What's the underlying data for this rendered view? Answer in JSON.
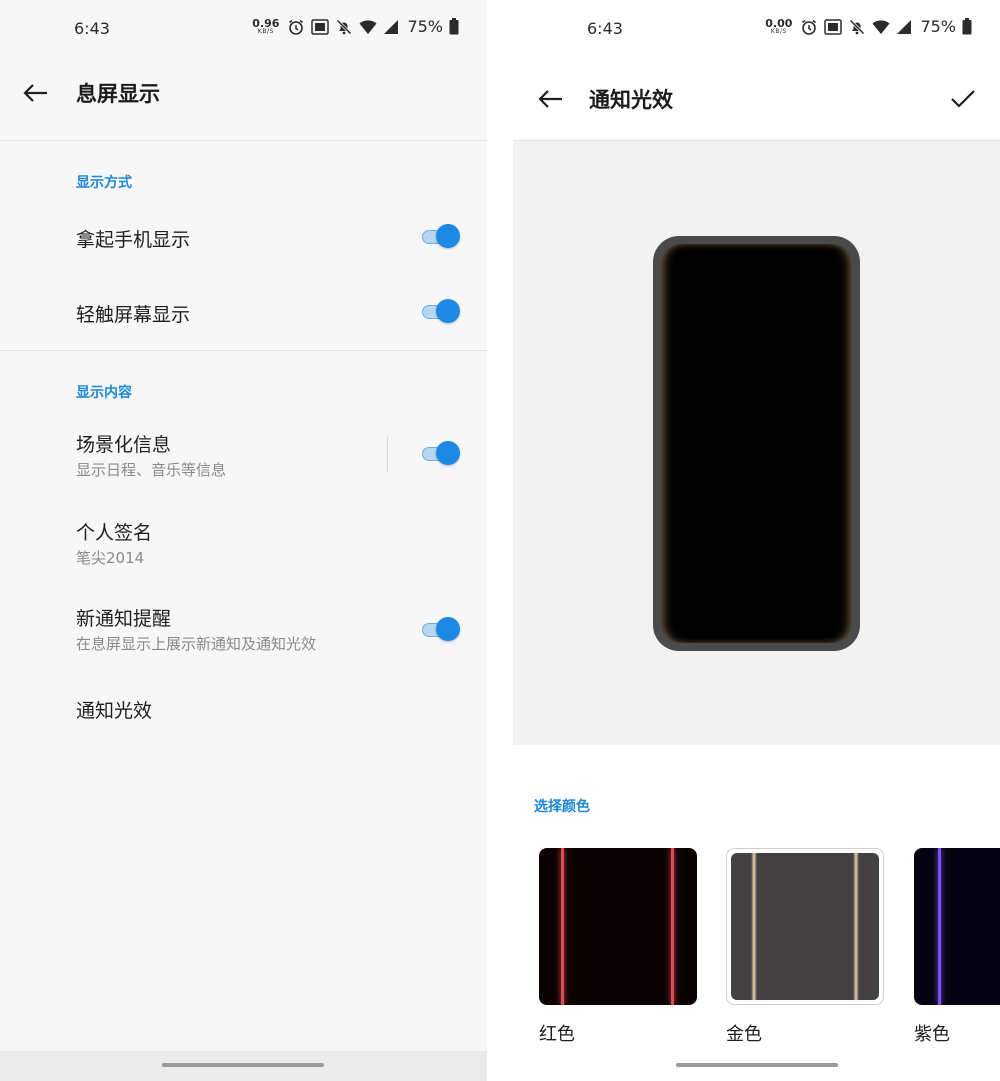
{
  "left_screen": {
    "status_bar": {
      "time": "6:43",
      "net_speed_value": "0.96",
      "net_speed_unit": "KB/S",
      "volte_label": "Vo LTE",
      "battery_pct": "75%"
    },
    "appbar": {
      "title": "息屏显示"
    },
    "sections": {
      "display_mode": {
        "title": "显示方式",
        "items": [
          {
            "title": "拿起手机显示",
            "toggle": true
          },
          {
            "title": "轻触屏幕显示",
            "toggle": true
          }
        ]
      },
      "display_content": {
        "title": "显示内容",
        "items": [
          {
            "title": "场景化信息",
            "subtitle": "显示日程、音乐等信息",
            "toggle": true
          },
          {
            "title": "个人签名",
            "subtitle": "笔尖2014"
          },
          {
            "title": "新通知提醒",
            "subtitle": "在息屏显示上展示新通知及通知光效",
            "toggle": true
          },
          {
            "title": "通知光效"
          }
        ]
      }
    }
  },
  "right_screen": {
    "status_bar": {
      "time": "6:43",
      "net_speed_value": "0.00",
      "net_speed_unit": "KB/S",
      "volte_label": "Vo LTE",
      "battery_pct": "75%"
    },
    "appbar": {
      "title": "通知光效"
    },
    "color_section": {
      "title": "选择颜色",
      "options": [
        {
          "label": "红色",
          "color": "#d9343f",
          "selected": false
        },
        {
          "label": "金色",
          "color": "#d9b88c",
          "selected": true
        },
        {
          "label": "紫色",
          "color": "#6a3be0",
          "selected": false
        }
      ]
    }
  },
  "colors": {
    "accent": "#1e88e5",
    "section_title": "#1e88d6"
  }
}
